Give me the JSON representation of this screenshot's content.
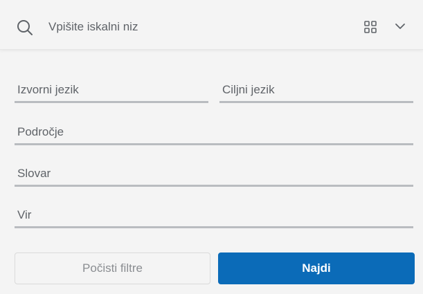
{
  "search": {
    "placeholder": "Vpišite iskalni niz",
    "value": ""
  },
  "icons": {
    "search": "search-icon",
    "layout": "grid-icon",
    "expand": "chevron-down-icon"
  },
  "filters": {
    "source_language": "Izvorni jezik",
    "target_language": "Ciljni jezik",
    "domain": "Področje",
    "dictionary": "Slovar",
    "source": "Vir"
  },
  "actions": {
    "clear_label": "Počisti filtre",
    "search_label": "Najdi"
  },
  "colors": {
    "background": "#f4f4f4",
    "primary": "#0b6bb8",
    "field_underline": "#b9bcc0",
    "text": "#5f6368"
  }
}
